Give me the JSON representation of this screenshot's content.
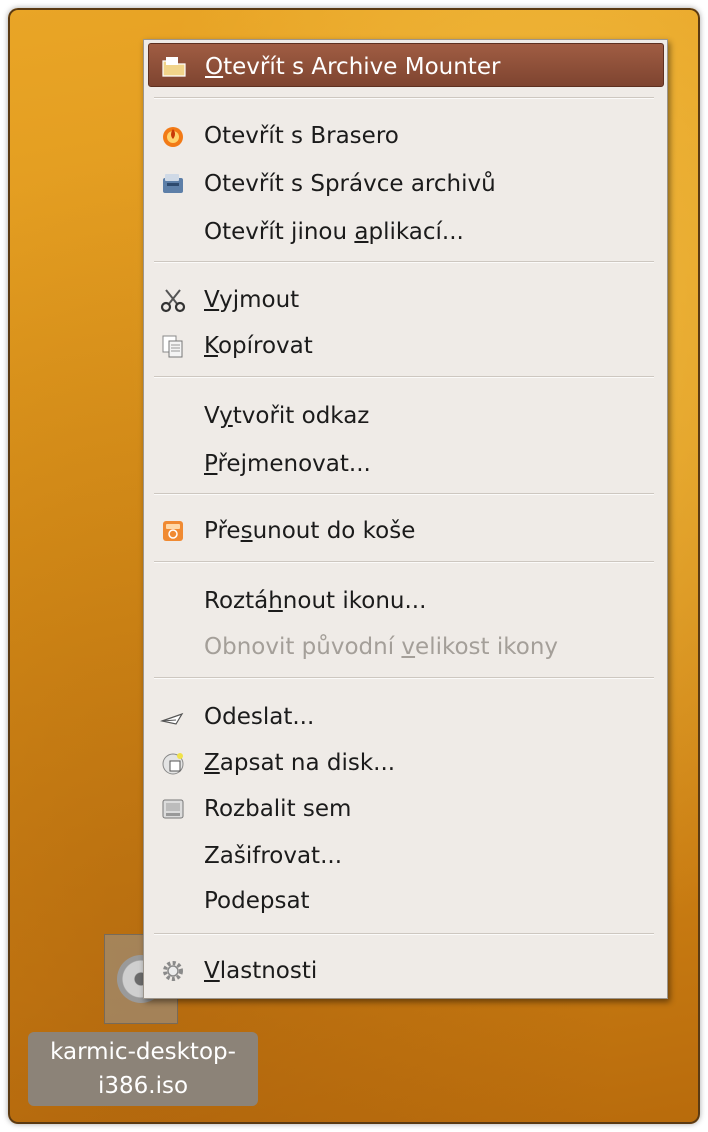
{
  "menu": {
    "items": [
      {
        "pre": "",
        "u": "O",
        "post": "tevřít s Archive Mounter",
        "icon": "archive-mounter-icon"
      },
      {
        "pre": "Otevřít s Brasero",
        "u": "",
        "post": "",
        "icon": "brasero-icon"
      },
      {
        "pre": "Otevřít s Správce archivů",
        "u": "",
        "post": "",
        "icon": "archive-manager-icon"
      },
      {
        "pre": "Otevřít jinou ",
        "u": "a",
        "post": "plikací...",
        "icon": ""
      },
      {
        "pre": "",
        "u": "V",
        "post": "yjmout",
        "icon": "scissors-icon"
      },
      {
        "pre": "",
        "u": "K",
        "post": "opírovat",
        "icon": "copy-icon"
      },
      {
        "pre": "V",
        "u": "y",
        "post": "tvořit odkaz",
        "icon": ""
      },
      {
        "pre": "",
        "u": "P",
        "post": "řejmenovat...",
        "icon": ""
      },
      {
        "pre": "Pře",
        "u": "s",
        "post": "unout do koše",
        "icon": "trash-icon"
      },
      {
        "pre": "Roztá",
        "u": "h",
        "post": "nout ikonu...",
        "icon": ""
      },
      {
        "pre": "Obnovit původní ",
        "u": "v",
        "post": "elikost ikony",
        "icon": ""
      },
      {
        "pre": "Odeslat...",
        "u": "",
        "post": "",
        "icon": "send-icon"
      },
      {
        "pre": "",
        "u": "Z",
        "post": "apsat na disk...",
        "icon": "burn-disc-icon"
      },
      {
        "pre": "Rozbalit sem",
        "u": "",
        "post": "",
        "icon": "extract-icon"
      },
      {
        "pre": "Zašifrovat...",
        "u": "",
        "post": "",
        "icon": ""
      },
      {
        "pre": "Podepsat",
        "u": "",
        "post": "",
        "icon": ""
      },
      {
        "pre": "",
        "u": "V",
        "post": "lastnosti",
        "icon": "properties-gear-icon"
      }
    ]
  },
  "desktop_icon": {
    "name_line1": "karmic-desktop-",
    "name_line2": "i386.iso",
    "icon": "iso-disc-icon"
  },
  "colors": {
    "selection": "#8f5038",
    "menu_bg": "#efebe7",
    "desktop": "#d99018",
    "disabled_text": "#a49f99"
  }
}
